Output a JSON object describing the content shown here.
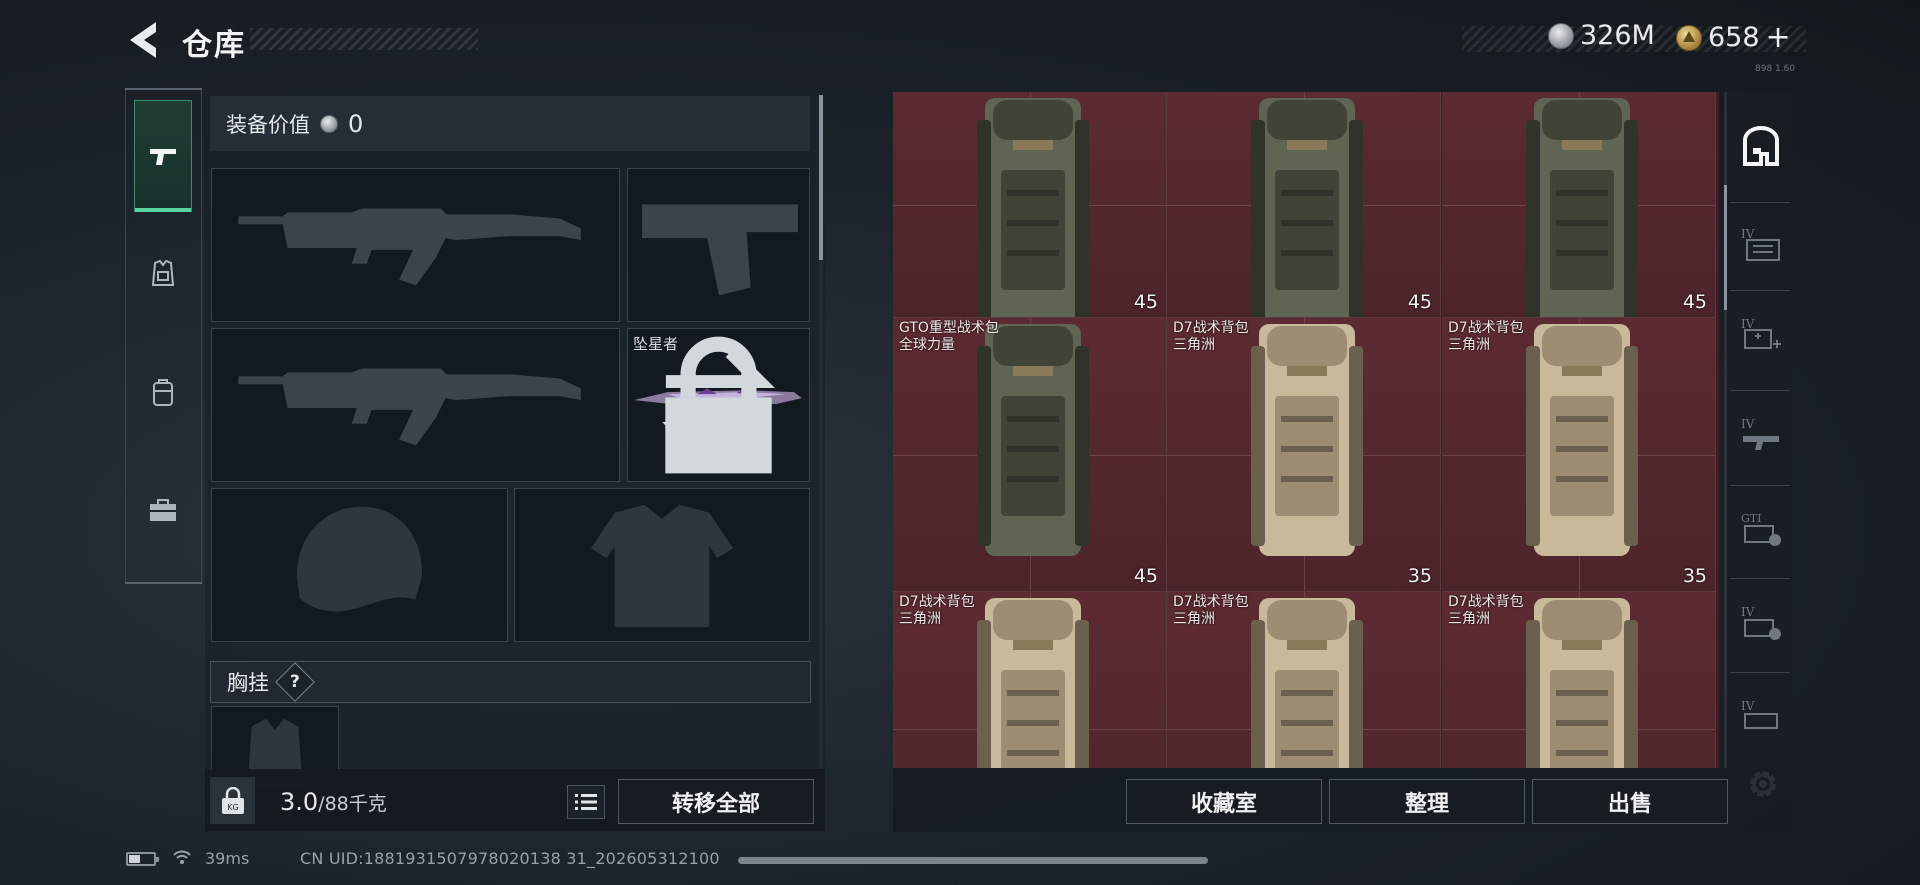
{
  "header": {
    "title": "仓库",
    "currency_silver": "326M",
    "currency_gold": "658",
    "add_symbol": "+",
    "version_tiny": "898 1.60"
  },
  "left_tabs": [
    {
      "name": "pistol-icon",
      "active": true
    },
    {
      "name": "chest-rig-icon",
      "active": false
    },
    {
      "name": "backpack-icon",
      "active": false
    },
    {
      "name": "toolbox-icon",
      "active": false
    }
  ],
  "equipment": {
    "value_label": "装备价值",
    "value": "0",
    "melee_name": "坠星者",
    "chest_label": "胸挂",
    "help_symbol": "?"
  },
  "weight": {
    "current": "3.0",
    "max": "/88千克",
    "lock_label": "KG"
  },
  "buttons": {
    "transfer_all": "转移全部",
    "collection": "收藏室",
    "sort": "整理",
    "sell": "出售"
  },
  "inventory": [
    {
      "name": "",
      "source": "",
      "count": "45",
      "color": "olive"
    },
    {
      "name": "",
      "source": "",
      "count": "45",
      "color": "olive"
    },
    {
      "name": "",
      "source": "",
      "count": "45",
      "color": "olive"
    },
    {
      "name": "GTO重型战术包",
      "source": "全球力量",
      "count": "45",
      "color": "olive"
    },
    {
      "name": "D7战术背包",
      "source": "三角洲",
      "count": "35",
      "color": "tan"
    },
    {
      "name": "D7战术背包",
      "source": "三角洲",
      "count": "35",
      "color": "tan"
    },
    {
      "name": "D7战术背包",
      "source": "三角洲",
      "count": "",
      "color": "tan"
    },
    {
      "name": "D7战术背包",
      "source": "三角洲",
      "count": "",
      "color": "tan"
    },
    {
      "name": "D7战术背包",
      "source": "三角洲",
      "count": "",
      "color": "tan"
    }
  ],
  "categories": [
    {
      "name": "all-items-icon",
      "label": ""
    },
    {
      "name": "tier-iv-container-icon",
      "label": "IV"
    },
    {
      "name": "tier-iv-medical-icon",
      "label": "IV"
    },
    {
      "name": "tier-iv-weapon-icon",
      "label": "IV"
    },
    {
      "name": "gti-ammo-icon",
      "label": "GTI"
    },
    {
      "name": "tier-iv-armor-icon",
      "label": "IV"
    },
    {
      "name": "tier-iv-misc-icon",
      "label": "IV"
    }
  ],
  "status": {
    "ping": "39ms",
    "uid": "CN UID:1881931507978020138 31_202605312100"
  },
  "colors": {
    "accent_green": "#57d3a0",
    "grid_bg": "#4b2429",
    "olive_pack": "#5d6350",
    "tan_pack": "#c8b89a"
  }
}
